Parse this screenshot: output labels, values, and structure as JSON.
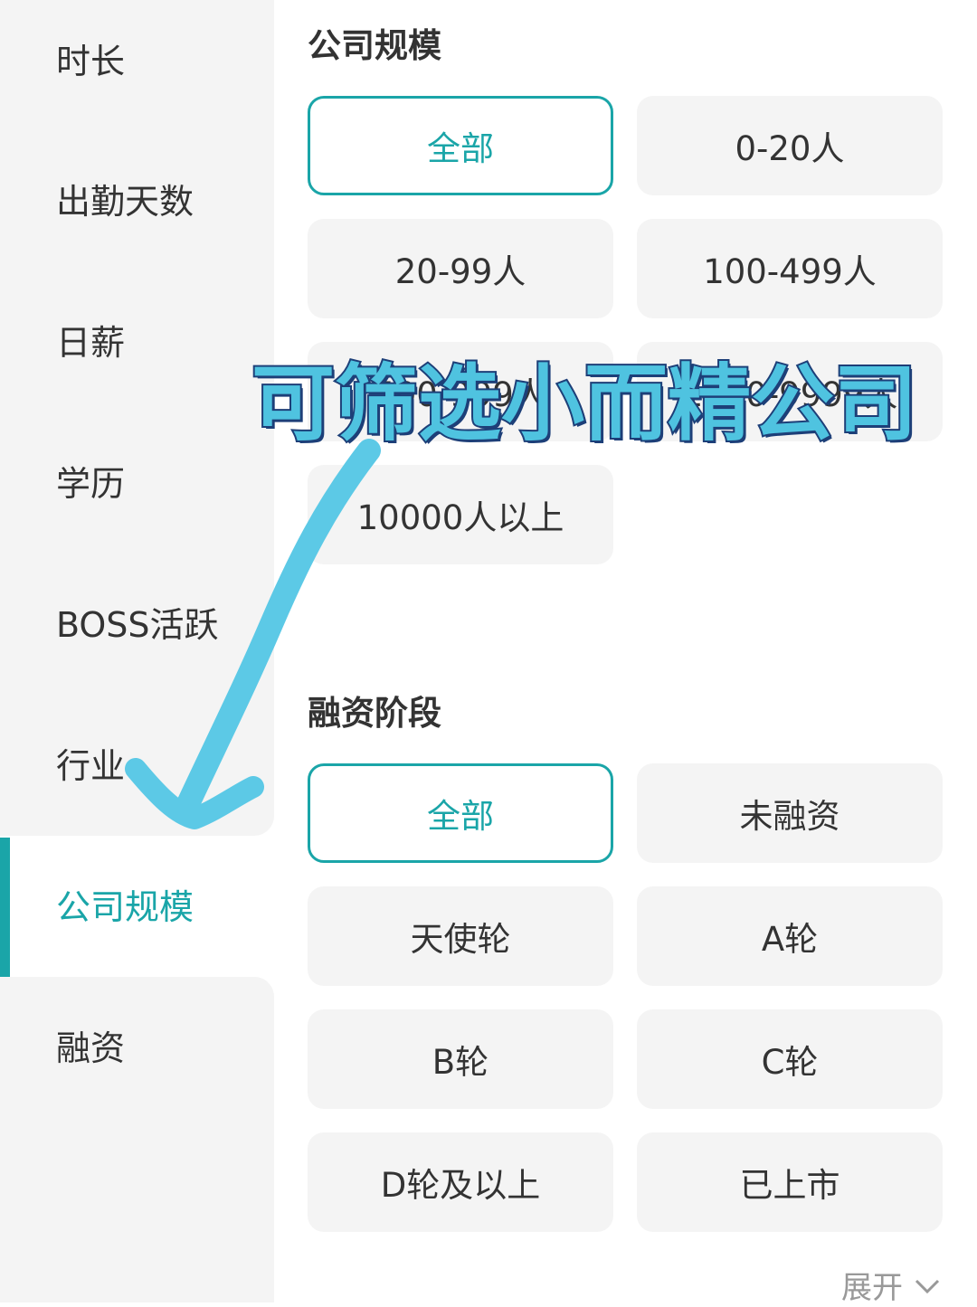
{
  "sidebar": {
    "items": [
      {
        "label": "时长"
      },
      {
        "label": "出勤天数"
      },
      {
        "label": "日薪"
      },
      {
        "label": "学历"
      },
      {
        "label": "BOSS活跃"
      },
      {
        "label": "行业"
      },
      {
        "label": "公司规模",
        "active": true
      },
      {
        "label": "融资"
      }
    ]
  },
  "company_size": {
    "title": "公司规模",
    "options": [
      "全部",
      "0-20人",
      "20-99人",
      "100-499人",
      "500-999人",
      "1000-9999人",
      "10000人以上"
    ],
    "selected": "全部"
  },
  "funding": {
    "title": "融资阶段",
    "options": [
      "全部",
      "未融资",
      "天使轮",
      "A轮",
      "B轮",
      "C轮",
      "D轮及以上",
      "已上市"
    ],
    "selected": "全部"
  },
  "expand_label": "展开",
  "overlay_caption": "可筛选小而精公司",
  "colors": {
    "accent": "#1aa5a8",
    "chip_bg": "#f4f4f4",
    "annotation": "#4fc3e0"
  }
}
